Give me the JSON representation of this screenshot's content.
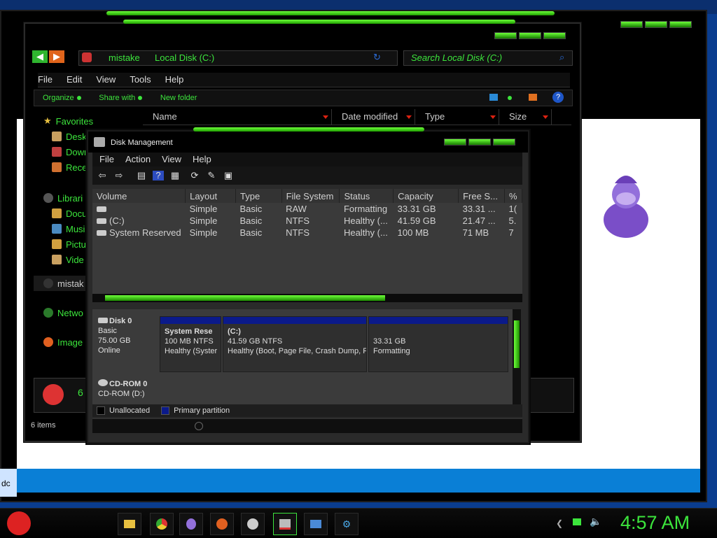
{
  "colors": {
    "accent_green": "#3ce53c",
    "desktop_blue": "#0a7fd6",
    "partition_blue": "#0b1a8a",
    "window_black": "#000000"
  },
  "explorer": {
    "breadcrumb": [
      "mistake",
      "Local Disk (C:)"
    ],
    "search_placeholder": "Search Local Disk (C:)",
    "menu": [
      "File",
      "Edit",
      "View",
      "Tools",
      "Help"
    ],
    "commands": [
      "Organize",
      "Share with",
      "New folder"
    ],
    "nav": {
      "favorites": "Favorites",
      "fav_items": [
        "Desk",
        "Down",
        "Rece"
      ],
      "libraries": "Librari",
      "lib_items": [
        "Docu",
        "Musi",
        "Pictu",
        "Vide"
      ],
      "homegroup": "mistak",
      "network": "Netwo",
      "image": "Image"
    },
    "columns": [
      "Name",
      "Date modified",
      "Type",
      "Size"
    ],
    "status": "6 items",
    "bottom_count": "6"
  },
  "diskmgmt": {
    "title": "Disk Management",
    "menu": [
      "File",
      "Action",
      "View",
      "Help"
    ],
    "columns": [
      "Volume",
      "Layout",
      "Type",
      "File System",
      "Status",
      "Capacity",
      "Free S...",
      "%"
    ],
    "volumes": [
      {
        "volume": "",
        "layout": "Simple",
        "type": "Basic",
        "fs": "RAW",
        "status": "Formatting",
        "capacity": "33.31 GB",
        "free": "33.31 ...",
        "pct": "1("
      },
      {
        "volume": "(C:)",
        "layout": "Simple",
        "type": "Basic",
        "fs": "NTFS",
        "status": "Healthy (...",
        "capacity": "41.59 GB",
        "free": "21.47 ...",
        "pct": "5."
      },
      {
        "volume": "System Reserved",
        "layout": "Simple",
        "type": "Basic",
        "fs": "NTFS",
        "status": "Healthy (...",
        "capacity": "100 MB",
        "free": "71 MB",
        "pct": "7"
      }
    ],
    "disk0": {
      "name": "Disk 0",
      "type": "Basic",
      "size": "75.00 GB",
      "state": "Online"
    },
    "partitions": [
      {
        "title": "System Rese",
        "line2": "100 MB NTFS",
        "line3": "Healthy (Syster"
      },
      {
        "title": "(C:)",
        "line2": "41.59 GB NTFS",
        "line3": "Healthy (Boot, Page File, Crash Dump, P"
      },
      {
        "title": "",
        "line2": "33.31 GB",
        "line3": "Formatting"
      }
    ],
    "cdrom": {
      "name": "CD-ROM 0",
      "drive": "CD-ROM (D:)"
    },
    "legend": [
      "Unallocated",
      "Primary partition"
    ]
  },
  "desktop": {
    "left_text": "dc"
  },
  "taskbar": {
    "clock": "4:57 AM"
  }
}
